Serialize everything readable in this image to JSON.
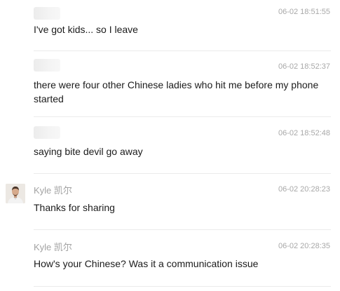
{
  "messages": [
    {
      "sender": "",
      "time": "06-02 18:51:55",
      "text": "I've got kids... so I leave"
    },
    {
      "sender": "",
      "time": "06-02 18:52:37",
      "text": "there were four other Chinese ladies who hit me before my phone started"
    },
    {
      "sender": "",
      "time": "06-02 18:52:48",
      "text": "saying bite devil go away"
    },
    {
      "sender": "Kyle 凯尔",
      "time": "06-02 20:28:23",
      "text": "Thanks for sharing"
    },
    {
      "sender": "Kyle 凯尔",
      "time": "06-02 20:28:35",
      "text": "How's your Chinese? Was it a communication issue"
    }
  ]
}
